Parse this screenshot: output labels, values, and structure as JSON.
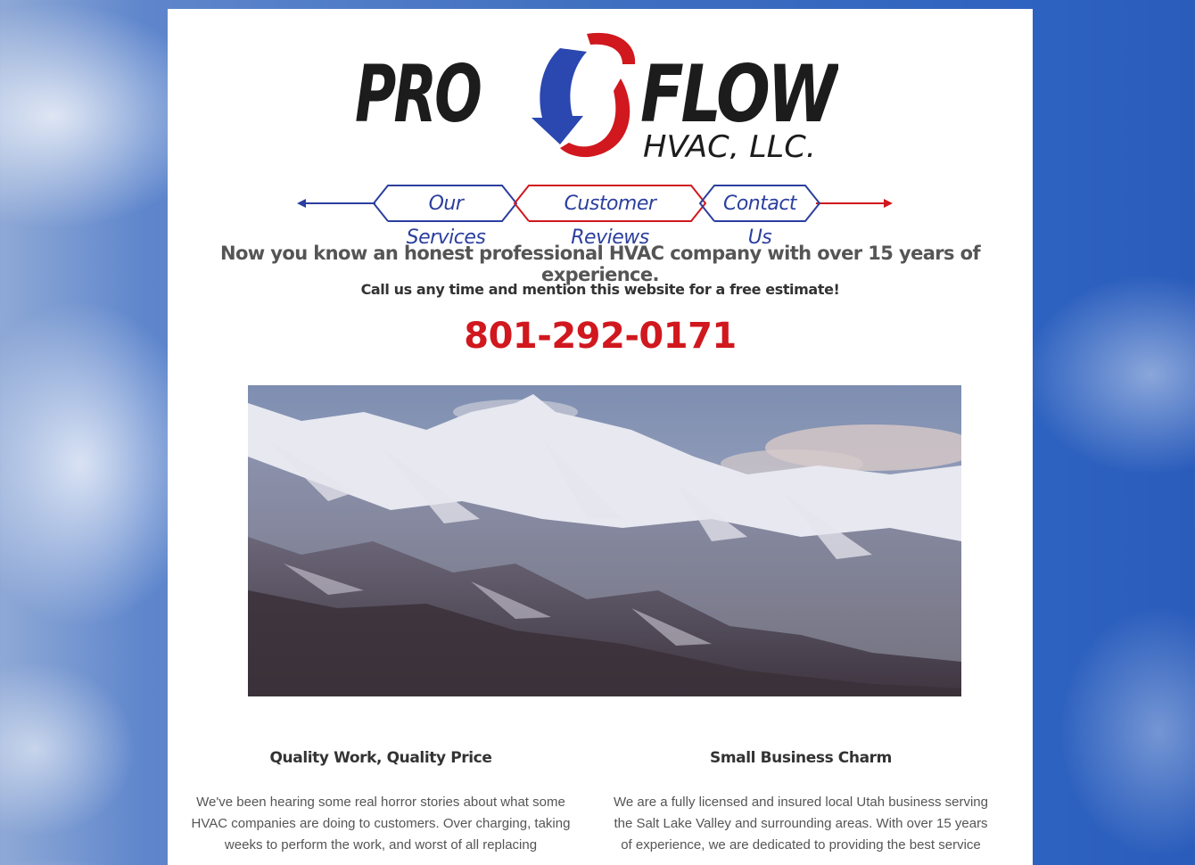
{
  "logo": {
    "brand_pro": "PRO",
    "brand_flow": "FLOW",
    "brand_sub": "HVAC, LLC."
  },
  "nav": {
    "items": [
      {
        "label": "Our Services"
      },
      {
        "label": "Customer Reviews"
      },
      {
        "label": "Contact Us"
      }
    ]
  },
  "main": {
    "headline": "Now you know an honest professional HVAC company with over 15 years of experience.",
    "subline": "Call us any time and mention this website for a free estimate!",
    "phone": "801-292-0171"
  },
  "columns": [
    {
      "title": "Quality Work, Quality Price",
      "text": "We've been hearing some real horror stories about what some HVAC companies are doing to customers. Over charging, taking weeks to perform the work, and worst of all replacing"
    },
    {
      "title": "Small Business Charm",
      "text": "We are a fully licensed and insured local Utah business serving the Salt Lake Valley and surrounding areas. With over 15 years of experience, we are dedicated to providing the best service"
    }
  ],
  "colors": {
    "brand_red": "#d0181e",
    "brand_blue": "#2b3f9e",
    "logo_black": "#1c1c1c"
  }
}
